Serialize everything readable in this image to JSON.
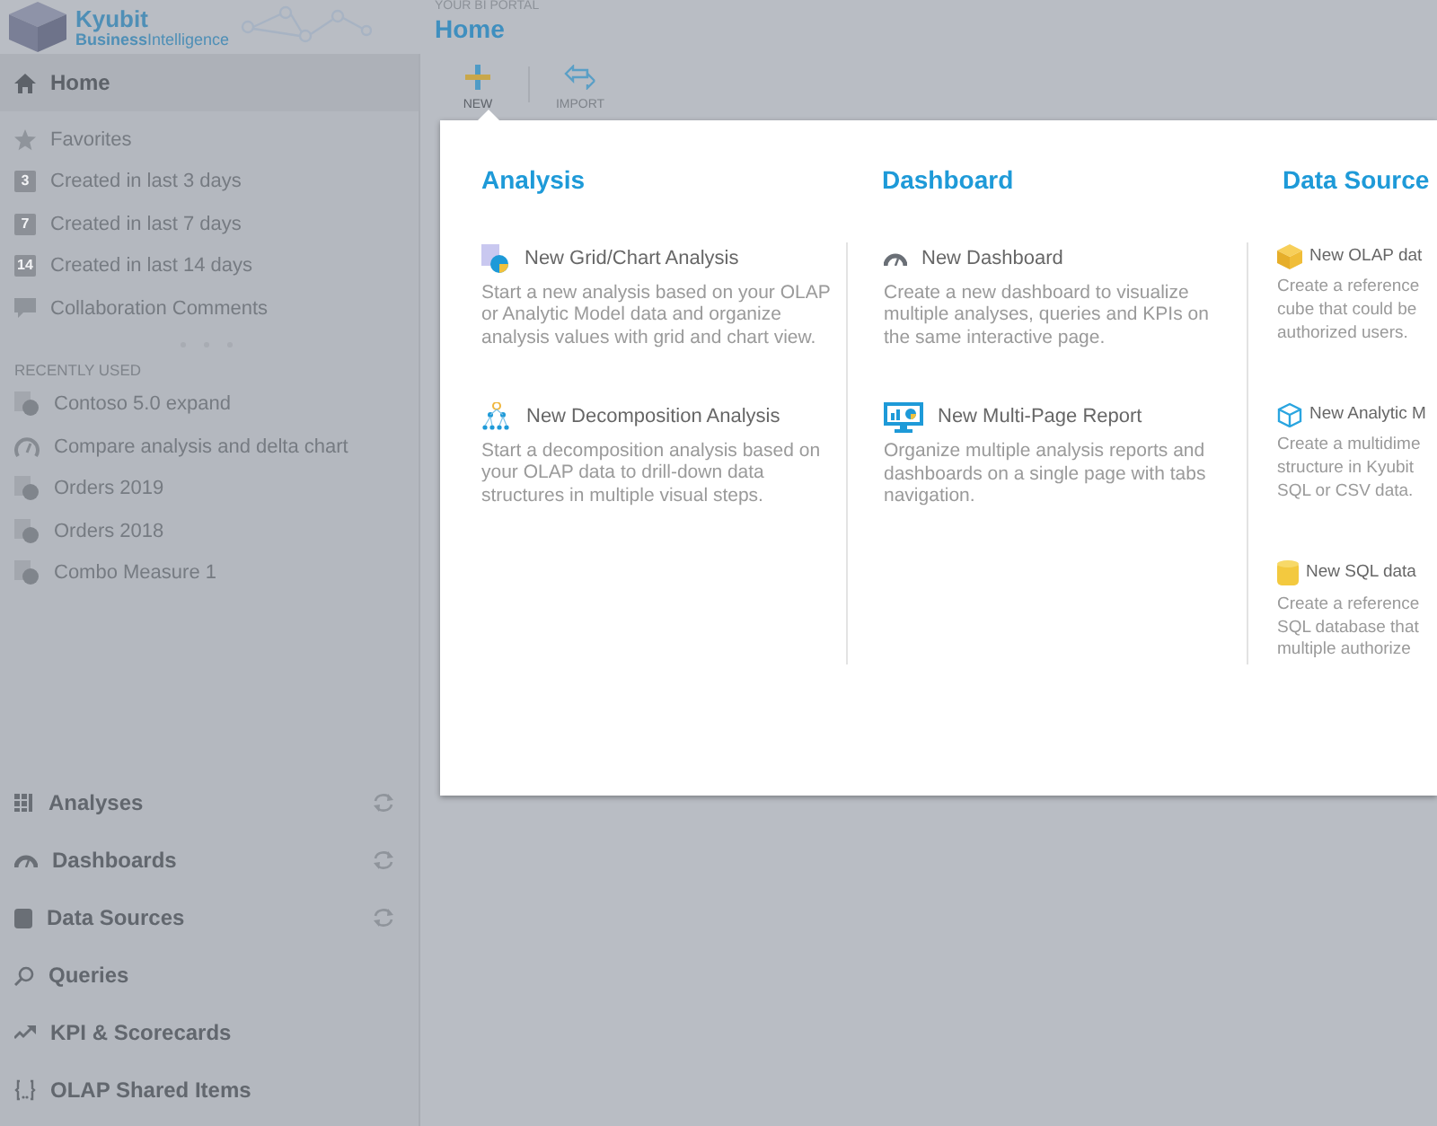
{
  "header": {
    "logo_title": "Kyubit",
    "logo_subtitle": "**Business**Intelligence",
    "portal_label": "YOUR BI PORTAL",
    "page_title": "Home"
  },
  "toolbar": [
    {
      "label": "NEW",
      "kind": "plus",
      "selected": true
    },
    {
      "label": "IMPORT",
      "kind": "arrows",
      "selected": false
    }
  ],
  "sidebar": {
    "home": {
      "label": "Home",
      "selected": true
    },
    "items": [
      {
        "kind": "star",
        "label": "Favorites"
      },
      {
        "kind": "badge",
        "badge": "3",
        "label": "Created in last 3 days"
      },
      {
        "kind": "badge",
        "badge": "7",
        "label": "Created in last 7 days"
      },
      {
        "kind": "badge",
        "badge": "14",
        "label": "Created in last 14 days"
      },
      {
        "kind": "comment",
        "label": "Collaboration Comments"
      }
    ],
    "recent_heading": "RECENTLY USED",
    "recent": [
      {
        "kind": "analysis",
        "label": "Contoso 5.0 expand"
      },
      {
        "kind": "dashboard",
        "label": "Compare analysis and delta chart"
      },
      {
        "kind": "analysis",
        "label": "Orders 2019"
      },
      {
        "kind": "analysis",
        "label": "Orders 2018"
      },
      {
        "kind": "analysis",
        "label": "Combo Measure 1"
      }
    ],
    "sections": [
      {
        "kind": "grid",
        "label": "Analyses",
        "refresh": true
      },
      {
        "kind": "gauge",
        "label": "Dashboards",
        "refresh": true
      },
      {
        "kind": "database",
        "label": "Data Sources",
        "refresh": true
      },
      {
        "kind": "search",
        "label": "Queries",
        "refresh": false
      },
      {
        "kind": "trend",
        "label": "KPI & Scorecards",
        "refresh": false
      },
      {
        "kind": "braces",
        "label": "OLAP Shared Items",
        "refresh": false
      }
    ]
  },
  "popup": {
    "columns": [
      {
        "heading": "Analysis",
        "items": [
          {
            "kind": "grid-chart",
            "title": "New Grid/Chart Analysis",
            "description_lines": [
              "Start a new analysis based on your OLAP",
              "or Analytic Model data and organize",
              "analysis values with grid and chart view."
            ]
          },
          {
            "kind": "tree",
            "title": "New Decomposition Analysis",
            "description_lines": [
              "Start a decomposition analysis based on",
              "your OLAP data to drill-down data",
              "structures in multiple visual steps."
            ]
          }
        ]
      },
      {
        "heading": "Dashboard",
        "items": [
          {
            "kind": "gauge",
            "title": "New Dashboard",
            "description_lines": [
              "Create a new dashboard to visualize",
              "multiple analyses, queries and KPIs on",
              "the same interactive page."
            ]
          },
          {
            "kind": "monitor",
            "title": "New Multi-Page Report",
            "description_lines": [
              "Organize multiple analysis reports and",
              "dashboards on a single page with tabs",
              "navigation."
            ]
          }
        ]
      },
      {
        "heading": "Data Source",
        "items": [
          {
            "kind": "cube",
            "title": "New OLAP dat",
            "description_lines": [
              "Create a reference",
              "cube that could be",
              "authorized users."
            ]
          },
          {
            "kind": "cube-outline",
            "title": "New Analytic M",
            "description_lines": [
              "Create a multidime",
              "structure in Kyubit",
              "SQL or CSV data."
            ]
          },
          {
            "kind": "cylinder",
            "title": "New SQL data",
            "description_lines": [
              "Create a reference",
              "SQL database that",
              "multiple authorize"
            ]
          }
        ]
      }
    ]
  }
}
